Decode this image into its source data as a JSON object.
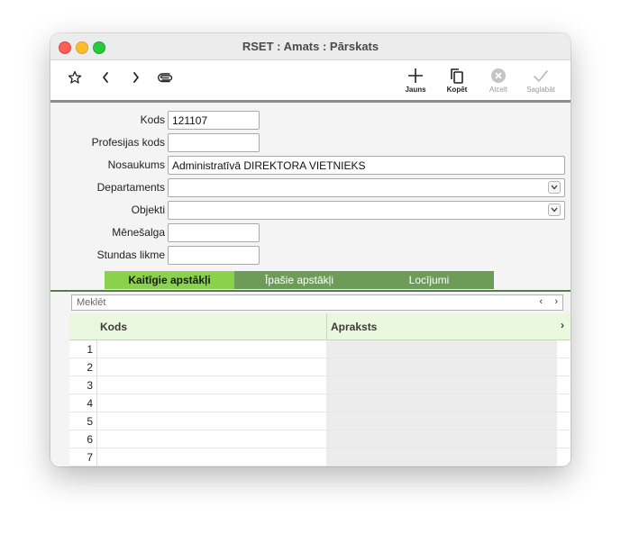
{
  "window": {
    "title": "RSET : Amats : Pārskats"
  },
  "toolbar": {
    "new_label": "Jauns",
    "copy_label": "Kopēt",
    "cancel_label": "Atcelt",
    "save_label": "Saglabāt"
  },
  "form": {
    "kods_label": "Kods",
    "kods_value": "121107",
    "profesijas_kods_label": "Profesijas kods",
    "profesijas_kods_value": "",
    "nosaukums_label": "Nosaukums",
    "nosaukums_value": "Administratīvā DIREKTORA VIETNIEKS",
    "departaments_label": "Departaments",
    "departaments_value": "",
    "objekti_label": "Objekti",
    "objekti_value": "",
    "menesalga_label": "Mēnešalga",
    "menesalga_value": "",
    "stundas_likme_label": "Stundas likme",
    "stundas_likme_value": ""
  },
  "tabs": [
    {
      "label": "Kaitīgie apstākļi",
      "active": true
    },
    {
      "label": "Īpašie apstākļi",
      "active": false
    },
    {
      "label": "Locījumi",
      "active": false
    }
  ],
  "search": {
    "placeholder": "Meklēt",
    "prev": "‹",
    "next": "›"
  },
  "grid": {
    "columns": [
      "Kods",
      "Apraksts"
    ],
    "more": "›",
    "rows": [
      "1",
      "2",
      "3",
      "4",
      "5",
      "6",
      "7"
    ]
  },
  "colors": {
    "tab_active": "#8ad24c",
    "tab_inactive": "#6e9c58",
    "grid_header": "#eaf8e0"
  }
}
